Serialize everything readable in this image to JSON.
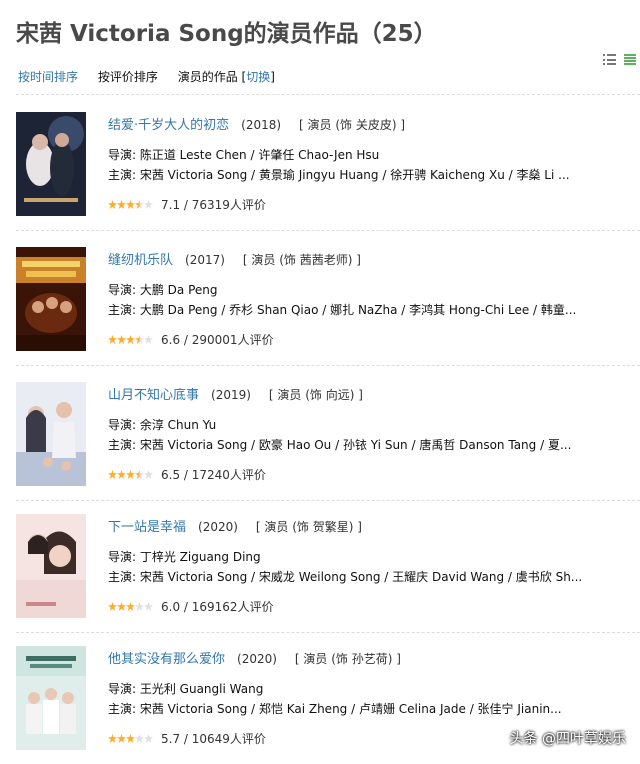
{
  "page_title": "宋茜 Victoria Song的演员作品（25）",
  "sort": {
    "by_time": "按时间排序",
    "by_rating": "按评价排序",
    "role_label": "演员的作品 [",
    "switch": "切换",
    "role_close": "]"
  },
  "view_icons": [
    "list-view-icon",
    "grid-view-icon"
  ],
  "colors": {
    "link": "#3377aa",
    "star": "#ffac2d",
    "star_empty": "#e0e0e0"
  },
  "movies": [
    {
      "title": "结爱·千岁大人的初恋",
      "year": "(2018)",
      "role": "[ 演员 (饰 关皮皮) ]",
      "director": "导演: 陈正道 Leste Chen / 许肇任 Chao-Jen Hsu",
      "cast": "主演: 宋茜 Victoria Song / 黄景瑜 Jingyu Huang / 徐开骋 Kaicheng Xu / 李燊 Li ...",
      "rating_text": "7.1 / 76319人评价",
      "stars": 3.5
    },
    {
      "title": "缝纫机乐队",
      "year": "(2017)",
      "role": "[ 演员 (饰 茜茜老师) ]",
      "director": "导演: 大鹏 Da Peng",
      "cast": "主演: 大鹏 Da Peng / 乔杉 Shan Qiao / 娜扎 NaZha / 李鸿其 Hong-Chi Lee / 韩童...",
      "rating_text": "6.6 / 290001人评价",
      "stars": 3.5
    },
    {
      "title": "山月不知心底事",
      "year": "(2019)",
      "role": "[ 演员 (饰 向远) ]",
      "director": "导演: 余淳 Chun Yu",
      "cast": "主演: 宋茜 Victoria Song / 欧豪 Hao Ou / 孙铱 Yi Sun / 唐禹哲 Danson Tang / 夏...",
      "rating_text": "6.5 / 17240人评价",
      "stars": 3.5
    },
    {
      "title": "下一站是幸福",
      "year": "(2020)",
      "role": "[ 演员 (饰 贺繁星) ]",
      "director": "导演: 丁梓光 Ziguang Ding",
      "cast": "主演: 宋茜 Victoria Song / 宋威龙 Weilong Song / 王耀庆 David Wang / 虞书欣 Sh...",
      "rating_text": "6.0 / 169162人评价",
      "stars": 3
    },
    {
      "title": "他其实没有那么爱你",
      "year": "(2020)",
      "role": "[ 演员 (饰 孙艺荷) ]",
      "director": "导演: 王光利 Guangli Wang",
      "cast": "主演: 宋茜 Victoria Song / 郑恺 Kai Zheng / 卢靖姗 Celina Jade / 张佳宁 Jianin...",
      "rating_text": "5.7 / 10649人评价",
      "stars": 3
    }
  ],
  "watermark": "头条 @四叶草娱乐"
}
